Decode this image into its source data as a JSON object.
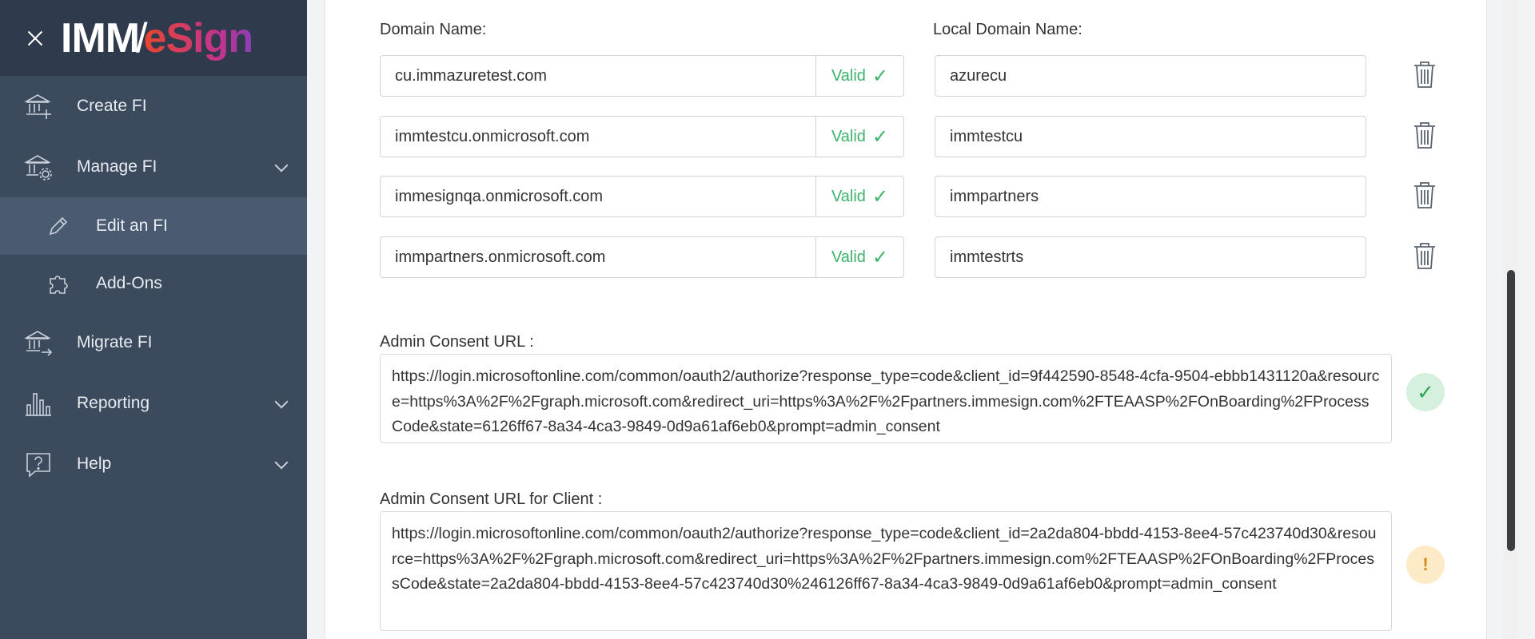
{
  "brand": {
    "logo_left": "IMM",
    "logo_slash": "/",
    "logo_right": "eSign"
  },
  "sidebar": {
    "items": [
      {
        "label": "Create FI",
        "icon": "bank-plus-icon"
      },
      {
        "label": "Manage FI",
        "icon": "bank-gear-icon"
      },
      {
        "label": "Edit an FI",
        "icon": "pencil-icon"
      },
      {
        "label": "Add-Ons",
        "icon": "puzzle-icon"
      },
      {
        "label": "Migrate FI",
        "icon": "bank-arrow-icon"
      },
      {
        "label": "Reporting",
        "icon": "bar-chart-icon"
      },
      {
        "label": "Help",
        "icon": "question-icon"
      }
    ]
  },
  "form": {
    "domain_label": "Domain Name:",
    "local_label": "Local Domain Name:",
    "valid_text": "Valid",
    "valid_check": "✓",
    "domains": [
      {
        "domain": "cu.immazuretest.com",
        "local": "azurecu"
      },
      {
        "domain": "immtestcu.onmicrosoft.com",
        "local": "immtestcu"
      },
      {
        "domain": "immesignqa.onmicrosoft.com",
        "local": "immpartners"
      },
      {
        "domain": "immpartners.onmicrosoft.com",
        "local": "immtestrts"
      }
    ],
    "admin_consent_label": "Admin Consent URL :",
    "admin_consent_url": "https://login.microsoftonline.com/common/oauth2/authorize?response_type=code&client_id=9f442590-8548-4cfa-9504-ebbb1431120a&resource=https%3A%2F%2Fgraph.microsoft.com&redirect_uri=https%3A%2F%2Fpartners.immesign.com%2FTEAASP%2FOnBoarding%2FProcessCode&state=6126ff67-8a34-4ca3-9849-0d9a61af6eb0&prompt=admin_consent",
    "admin_consent_status": "✓",
    "client_consent_label": "Admin Consent URL for Client :",
    "client_consent_url": "https://login.microsoftonline.com/common/oauth2/authorize?response_type=code&client_id=2a2da804-bbdd-4153-8ee4-57c423740d30&resource=https%3A%2F%2Fgraph.microsoft.com&redirect_uri=https%3A%2F%2Fpartners.immesign.com%2FTEAASP%2FOnBoarding%2FProcessCode&state=2a2da804-bbdd-4153-8ee4-57c423740d30%246126ff67-8a34-4ca3-9849-0d9a61af6eb0&prompt=admin_consent",
    "client_consent_status": "!"
  },
  "colors": {
    "sidebar": "#3c4a5e",
    "brand_bar": "#2f3b4c",
    "valid_green": "#3bb36b",
    "warn_amber": "#d6891c"
  }
}
